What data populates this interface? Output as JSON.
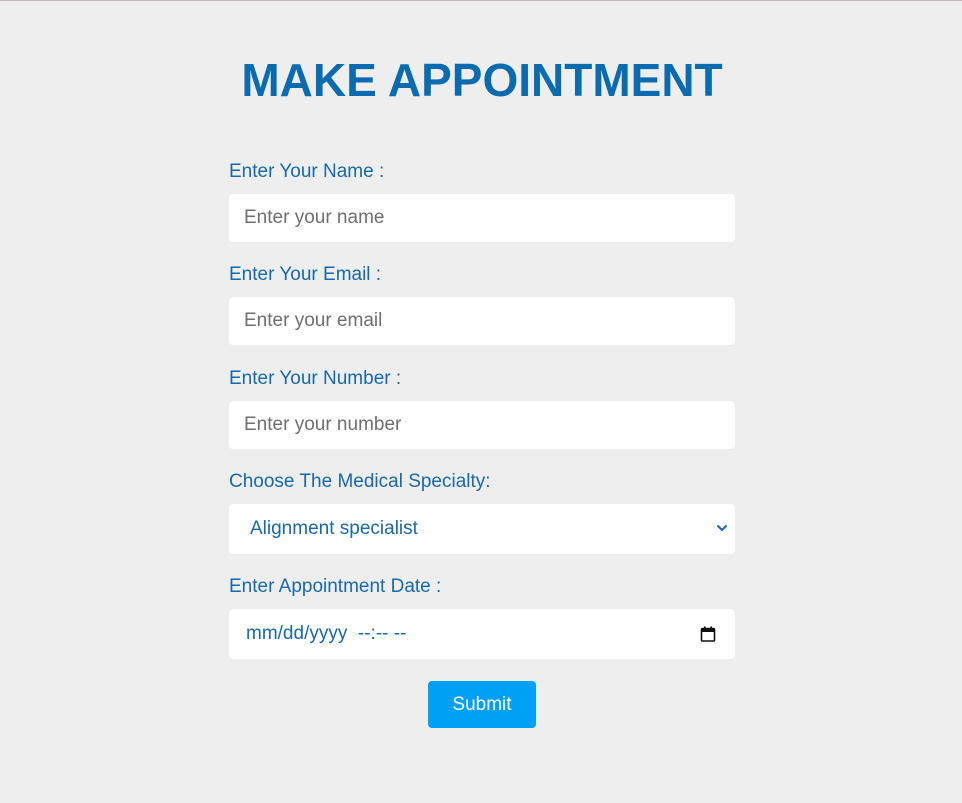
{
  "page": {
    "title": "MAKE APPOINTMENT",
    "colors": {
      "title": "#0b6bb0",
      "label": "#1769ad",
      "button": "#00a0f5",
      "background": "#eeeeee"
    }
  },
  "form": {
    "name": {
      "label": "Enter Your Name :",
      "placeholder": "Enter your name",
      "value": ""
    },
    "email": {
      "label": "Enter Your Email :",
      "placeholder": "Enter your email",
      "value": ""
    },
    "number": {
      "label": "Enter Your Number :",
      "placeholder": "Enter your number",
      "value": ""
    },
    "specialty": {
      "label": "Choose The Medical Specialty:",
      "selected": "Alignment specialist",
      "icon": "chevron-down-icon"
    },
    "date": {
      "label": "Enter Appointment Date :",
      "display": "mm/dd/yyyy  --:-- --",
      "icon": "calendar-icon"
    },
    "submit_label": "Submit"
  }
}
